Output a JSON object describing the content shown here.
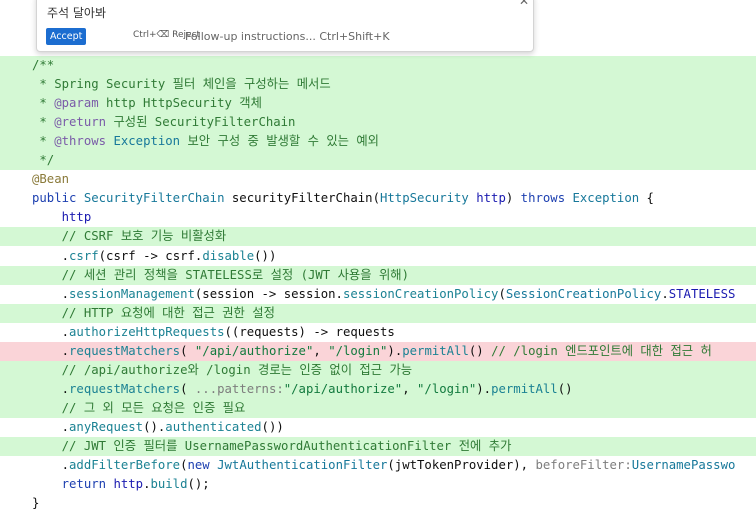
{
  "popup": {
    "title": "주석 달아봐",
    "accept_label": "Accept",
    "reject_label": "Ctrl+⌫ Reject",
    "followup_label": "Follow-up instructions... Ctrl+Shift+K",
    "close_icon": "close-icon"
  },
  "code": {
    "lines": [
      {
        "bg": "add",
        "tokens": [
          {
            "c": "com",
            "t": "/**"
          }
        ]
      },
      {
        "bg": "add",
        "tokens": [
          {
            "c": "com",
            "t": " * Spring Security 필터 체인을 구성하는 메서드"
          }
        ]
      },
      {
        "bg": "add",
        "tokens": [
          {
            "c": "com",
            "t": " * "
          },
          {
            "c": "tag",
            "t": "@param"
          },
          {
            "c": "com",
            "t": " http HttpSecurity 객체"
          }
        ]
      },
      {
        "bg": "add",
        "tokens": [
          {
            "c": "com",
            "t": " * "
          },
          {
            "c": "tag",
            "t": "@return"
          },
          {
            "c": "com",
            "t": " 구성된 SecurityFilterChain"
          }
        ]
      },
      {
        "bg": "add",
        "tokens": [
          {
            "c": "com",
            "t": " * "
          },
          {
            "c": "tag",
            "t": "@throws"
          },
          {
            "c": "type",
            "t": " Exception"
          },
          {
            "c": "com",
            "t": " 보안 구성 중 발생할 수 있는 예외"
          }
        ]
      },
      {
        "bg": "add",
        "tokens": [
          {
            "c": "com",
            "t": " */"
          }
        ]
      },
      {
        "bg": "none",
        "tokens": [
          {
            "c": "ann",
            "t": "@Bean"
          }
        ]
      },
      {
        "bg": "none",
        "tokens": [
          {
            "c": "kw",
            "t": "public "
          },
          {
            "c": "type",
            "t": "SecurityFilterChain "
          },
          {
            "c": "plain",
            "t": "securityFilterChain("
          },
          {
            "c": "type",
            "t": "HttpSecurity "
          },
          {
            "c": "var",
            "t": "http"
          },
          {
            "c": "plain",
            "t": ") "
          },
          {
            "c": "kw",
            "t": "throws "
          },
          {
            "c": "type",
            "t": "Exception "
          },
          {
            "c": "plain",
            "t": "{"
          }
        ]
      },
      {
        "bg": "none",
        "tokens": [
          {
            "c": "var",
            "t": "    http"
          }
        ]
      },
      {
        "bg": "add",
        "tokens": [
          {
            "c": "com",
            "t": "    // CSRF 보호 기능 비활성화"
          }
        ]
      },
      {
        "bg": "none",
        "tokens": [
          {
            "c": "plain",
            "t": "    ."
          },
          {
            "c": "fn",
            "t": "csrf"
          },
          {
            "c": "plain",
            "t": "(csrf -> csrf."
          },
          {
            "c": "fn",
            "t": "disable"
          },
          {
            "c": "plain",
            "t": "())"
          }
        ]
      },
      {
        "bg": "add",
        "tokens": [
          {
            "c": "com",
            "t": "    // 세션 관리 정책을 STATELESS로 설정 (JWT 사용을 위해)"
          }
        ]
      },
      {
        "bg": "none",
        "tokens": [
          {
            "c": "plain",
            "t": "    ."
          },
          {
            "c": "fn",
            "t": "sessionManagement"
          },
          {
            "c": "plain",
            "t": "(session -> session."
          },
          {
            "c": "fn",
            "t": "sessionCreationPolicy"
          },
          {
            "c": "plain",
            "t": "("
          },
          {
            "c": "type",
            "t": "SessionCreationPolicy"
          },
          {
            "c": "plain",
            "t": "."
          },
          {
            "c": "var",
            "t": "STATELESS"
          }
        ]
      },
      {
        "bg": "add",
        "tokens": [
          {
            "c": "com",
            "t": "    // HTTP 요청에 대한 접근 권한 설정"
          }
        ]
      },
      {
        "bg": "none",
        "tokens": [
          {
            "c": "plain",
            "t": "    ."
          },
          {
            "c": "fn",
            "t": "authorizeHttpRequests"
          },
          {
            "c": "plain",
            "t": "((requests) -> requests"
          }
        ]
      },
      {
        "bg": "del",
        "tokens": [
          {
            "c": "plain",
            "t": "    ."
          },
          {
            "c": "fn",
            "t": "requestMatchers"
          },
          {
            "c": "plain",
            "t": "( "
          },
          {
            "c": "str",
            "t": "\"/api/authorize\""
          },
          {
            "c": "plain",
            "t": ", "
          },
          {
            "c": "str",
            "t": "\"/login\""
          },
          {
            "c": "plain",
            "t": ")."
          },
          {
            "c": "fn",
            "t": "permitAll"
          },
          {
            "c": "plain",
            "t": "() "
          },
          {
            "c": "com",
            "t": "// /login 엔드포인트에 대한 접근 허"
          }
        ]
      },
      {
        "bg": "add",
        "tokens": [
          {
            "c": "com",
            "t": "    // /api/authorize와 /login 경로는 인증 없이 접근 가능"
          }
        ]
      },
      {
        "bg": "add",
        "tokens": [
          {
            "c": "plain",
            "t": "    ."
          },
          {
            "c": "fn",
            "t": "requestMatchers"
          },
          {
            "c": "plain",
            "t": "( "
          },
          {
            "c": "hint",
            "t": "...patterns:"
          },
          {
            "c": "str",
            "t": "\"/api/authorize\""
          },
          {
            "c": "plain",
            "t": ", "
          },
          {
            "c": "str",
            "t": "\"/login\""
          },
          {
            "c": "plain",
            "t": ")."
          },
          {
            "c": "fn",
            "t": "permitAll"
          },
          {
            "c": "plain",
            "t": "()"
          }
        ]
      },
      {
        "bg": "add",
        "tokens": [
          {
            "c": "com",
            "t": "    // 그 외 모든 요청은 인증 필요"
          }
        ]
      },
      {
        "bg": "none",
        "tokens": [
          {
            "c": "plain",
            "t": "    ."
          },
          {
            "c": "fn",
            "t": "anyRequest"
          },
          {
            "c": "plain",
            "t": "()."
          },
          {
            "c": "fn",
            "t": "authenticated"
          },
          {
            "c": "plain",
            "t": "())"
          }
        ]
      },
      {
        "bg": "add",
        "tokens": [
          {
            "c": "com",
            "t": "    // JWT 인증 필터를 UsernamePasswordAuthenticationFilter 전에 추가"
          }
        ]
      },
      {
        "bg": "none",
        "tokens": [
          {
            "c": "plain",
            "t": "    ."
          },
          {
            "c": "fn",
            "t": "addFilterBefore"
          },
          {
            "c": "plain",
            "t": "("
          },
          {
            "c": "kw",
            "t": "new "
          },
          {
            "c": "type",
            "t": "JwtAuthenticationFilter"
          },
          {
            "c": "plain",
            "t": "(jwtTokenProvider), "
          },
          {
            "c": "hint",
            "t": "beforeFilter:"
          },
          {
            "c": "type",
            "t": "UsernamePasswo"
          }
        ]
      },
      {
        "bg": "none",
        "tokens": [
          {
            "c": "kw",
            "t": "    return "
          },
          {
            "c": "var",
            "t": "http"
          },
          {
            "c": "plain",
            "t": "."
          },
          {
            "c": "fn",
            "t": "build"
          },
          {
            "c": "plain",
            "t": "();"
          }
        ]
      },
      {
        "bg": "none",
        "tokens": [
          {
            "c": "plain",
            "t": "}"
          }
        ]
      }
    ]
  }
}
